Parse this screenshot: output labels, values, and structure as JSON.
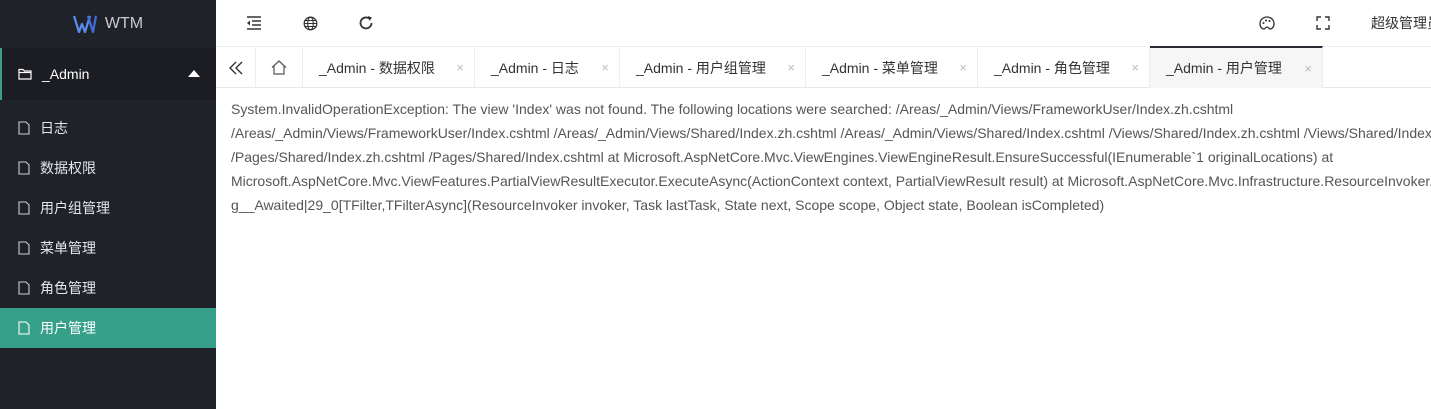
{
  "app": {
    "name": "WTM"
  },
  "sidebar": {
    "group": {
      "label": "_Admin"
    },
    "items": [
      {
        "label": "日志"
      },
      {
        "label": "数据权限"
      },
      {
        "label": "用户组管理"
      },
      {
        "label": "菜单管理"
      },
      {
        "label": "角色管理"
      },
      {
        "label": "用户管理"
      }
    ]
  },
  "header": {
    "icons": [
      "indent-icon",
      "globe-icon",
      "refresh-icon",
      "theme-icon",
      "fullscreen-icon"
    ],
    "user": "超级管理员"
  },
  "tabs": [
    {
      "label": "_Admin - 数据权限",
      "close": "×"
    },
    {
      "label": "_Admin - 日志",
      "close": "×"
    },
    {
      "label": "_Admin - 用户组管理",
      "close": "×"
    },
    {
      "label": "_Admin - 菜单管理",
      "close": "×"
    },
    {
      "label": "_Admin - 角色管理",
      "close": "×"
    },
    {
      "label": "_Admin - 用户管理",
      "close": "×"
    }
  ],
  "content": {
    "lines": [
      "System.InvalidOperationException: The view 'Index' was not found. The following locations were searched: /Areas/_Admin/Views/FrameworkUser/Index.zh.cshtml",
      "/Areas/_Admin/Views/FrameworkUser/Index.cshtml /Areas/_Admin/Views/Shared/Index.zh.cshtml /Areas/_Admin/Views/Shared/Index.cshtml /Views/Shared/Index.zh.cshtml /Views/Shared/Index.cshtml",
      "/Pages/Shared/Index.zh.cshtml /Pages/Shared/Index.cshtml at Microsoft.AspNetCore.Mvc.ViewEngines.ViewEngineResult.EnsureSuccessful(IEnumerable`1 originalLocations) at",
      "Microsoft.AspNetCore.Mvc.ViewFeatures.PartialViewResultExecutor.ExecuteAsync(ActionContext context, PartialViewResult result) at Microsoft.AspNetCore.Mvc.Infrastructure.ResourceInvoker.<InvokeNextResultFilterAsync>",
      "g__Awaited|29_0[TFilter,TFilterAsync](ResourceInvoker invoker, Task lastTask, State next, Scope scope, Object state, Boolean isCompleted)"
    ]
  }
}
